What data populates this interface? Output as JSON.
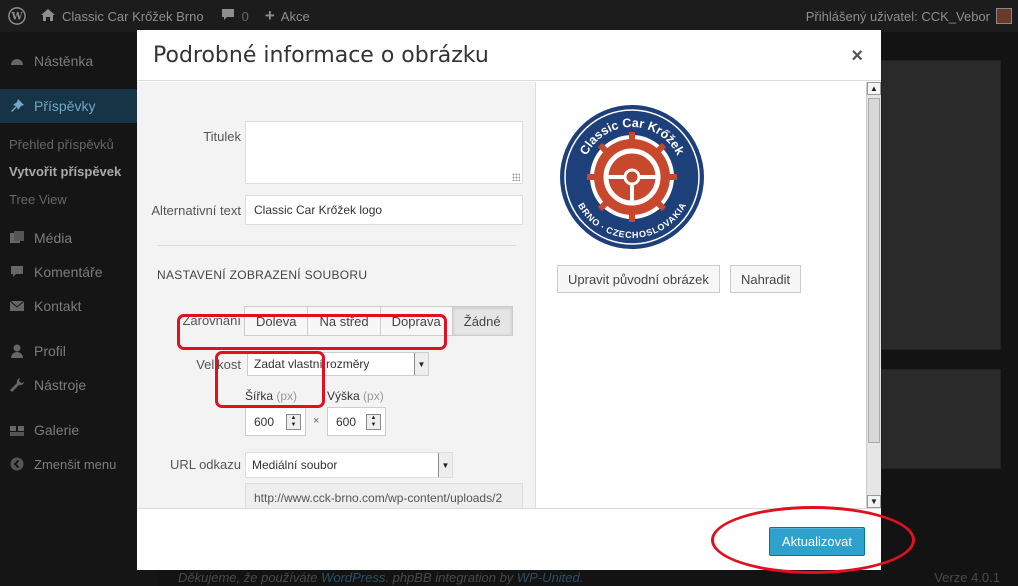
{
  "adminbar": {
    "site_name": "Classic Car Krőžek Brno",
    "comments_count": "0",
    "new_label": "Akce",
    "user_label": "Přihlášený uživatel: CCK_Vebor"
  },
  "sidebar": {
    "items": [
      {
        "label": "Nástěnka"
      },
      {
        "label": "Příspěvky"
      },
      {
        "label": "Média"
      },
      {
        "label": "Komentáře"
      },
      {
        "label": "Kontakt"
      },
      {
        "label": "Profil"
      },
      {
        "label": "Nástroje"
      },
      {
        "label": "Galerie"
      },
      {
        "label": "Zmenšit menu"
      }
    ],
    "subitems": [
      {
        "label": "Přehled příspěvků"
      },
      {
        "label": "Vytvořit příspěvek"
      },
      {
        "label": "Tree View"
      }
    ]
  },
  "footer": {
    "thanks_prefix": "Děkujeme, že používáte ",
    "wp_link": "WordPress",
    "mid": ". phpBB integration by ",
    "wpu_link": "WP-United",
    "end": ".",
    "version": "Verze 4.0.1"
  },
  "modal": {
    "title": "Podrobné informace o obrázku",
    "close_symbol": "×",
    "caption_label": "Titulek",
    "caption_value": "",
    "alt_label": "Alternativní text",
    "alt_value": "Classic Car Krőžek logo",
    "section_title": "NASTAVENÍ ZOBRAZENÍ SOUBORU",
    "align_label": "Zarovnání",
    "align_options": [
      "Doleva",
      "Na střed",
      "Doprava",
      "Žádné"
    ],
    "align_selected": "Žádné",
    "size_label": "Velikost",
    "size_value": "Zadat vlastní rozměry",
    "width_label": "Šířka",
    "height_label": "Výška",
    "px_unit": "(px)",
    "width_value": "600",
    "height_value": "600",
    "times_symbol": "×",
    "link_label": "URL odkazu",
    "link_value": "Mediální soubor",
    "link_url": "http://www.cck-brno.com/wp-content/uploads/2",
    "edit_original_button": "Upravit původní obrázek",
    "replace_button": "Nahradit",
    "update_button": "Aktualizovat"
  },
  "logo": {
    "top_text": "Classic Car Krőžek",
    "bottom_text": "BRNO · CZECHOSLOVAKIA",
    "colors": {
      "ring": "#1d3f7a",
      "gear": "#c8482e"
    }
  }
}
